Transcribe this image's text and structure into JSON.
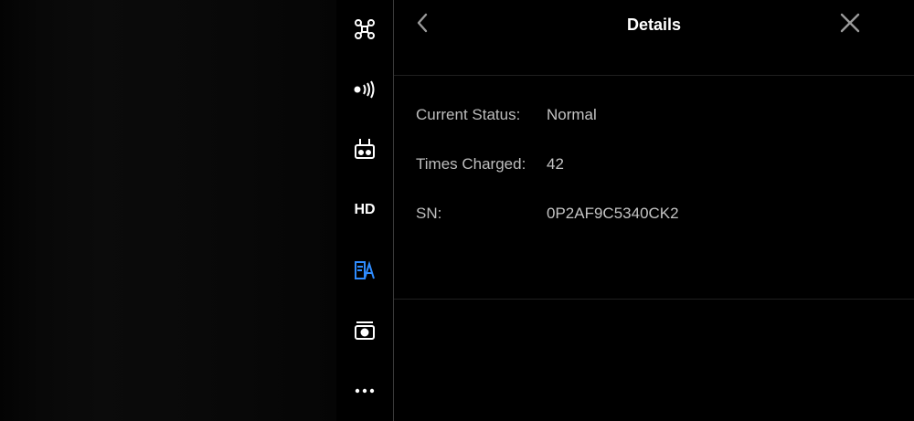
{
  "panel": {
    "title": "Details",
    "back_icon": "chevron-left-icon",
    "close_icon": "close-icon"
  },
  "details": [
    {
      "label": "Current Status:",
      "value": "Normal"
    },
    {
      "label": "Times Charged:",
      "value": "42"
    },
    {
      "label": "SN:",
      "value": "0P2AF9C5340CK2"
    }
  ],
  "rail": {
    "items": [
      {
        "name": "aircraft",
        "icon": "drone-icon"
      },
      {
        "name": "sensors",
        "icon": "signal-icon"
      },
      {
        "name": "remote-controller",
        "icon": "remote-controller-icon"
      },
      {
        "name": "hd",
        "icon": "hd-icon",
        "label": "HD"
      },
      {
        "name": "battery",
        "icon": "battery-icon",
        "active": true
      },
      {
        "name": "camera",
        "icon": "camera-icon"
      },
      {
        "name": "more",
        "icon": "more-icon"
      }
    ]
  },
  "colors": {
    "background": "#000000",
    "text_primary": "#ffffff",
    "text_secondary": "#bdbdbd",
    "accent": "#2f8cff",
    "divider": "#3a3a3a"
  }
}
